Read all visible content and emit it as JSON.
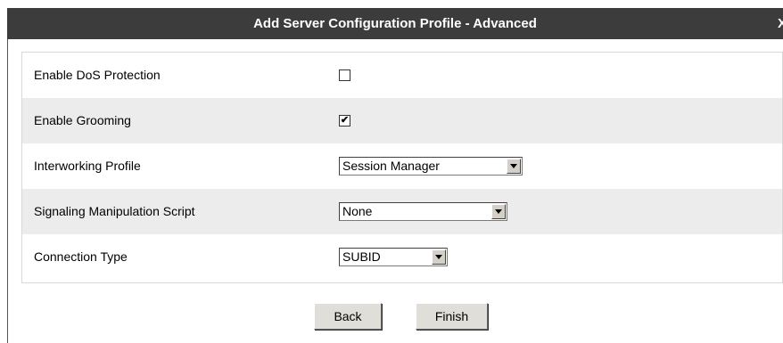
{
  "dialog": {
    "title": "Add Server Configuration Profile - Advanced",
    "close_label": "X"
  },
  "form": {
    "rows": [
      {
        "label": "Enable DoS Protection",
        "control": "checkbox",
        "checked": false,
        "mark": ""
      },
      {
        "label": "Enable Grooming",
        "control": "checkbox",
        "checked": true,
        "mark": "✔"
      },
      {
        "label": "Interworking Profile",
        "control": "select",
        "value": "Session Manager"
      },
      {
        "label": "Signaling Manipulation Script",
        "control": "select",
        "value": "None"
      },
      {
        "label": "Connection Type",
        "control": "select",
        "value": "SUBID"
      }
    ]
  },
  "buttons": {
    "back": "Back",
    "finish": "Finish"
  },
  "icons": {
    "dropdown": "chevron-down-icon",
    "checkbox_check": "check-icon",
    "close": "close-icon"
  }
}
